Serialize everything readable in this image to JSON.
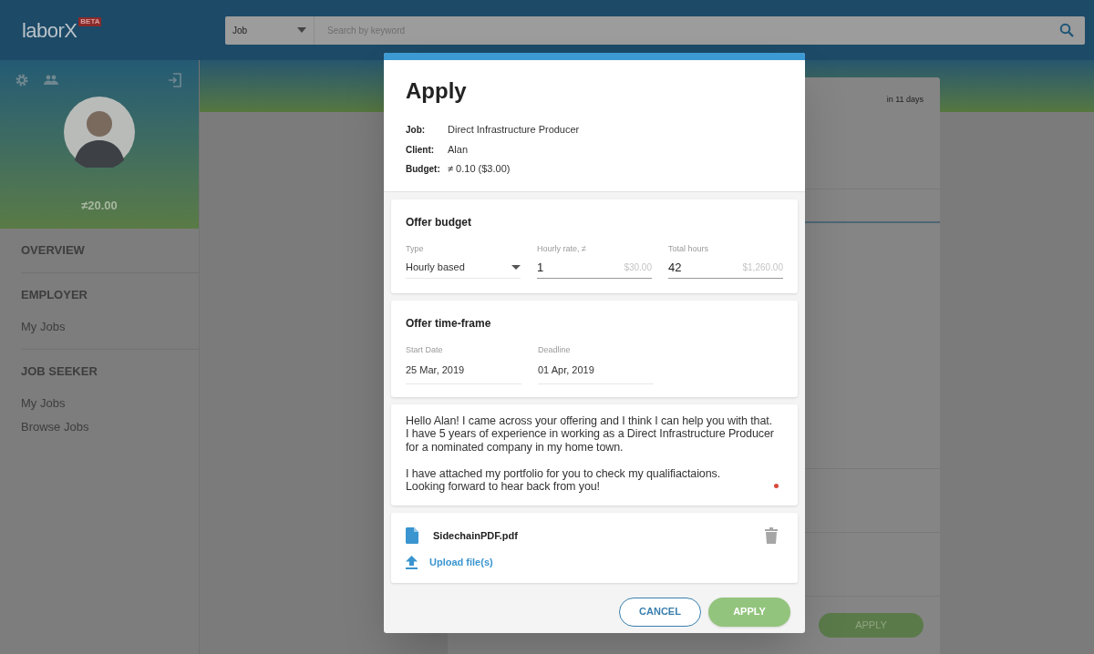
{
  "header": {
    "logo": "laborX",
    "badge": "BETA",
    "search": {
      "category": "Job",
      "placeholder": "Search by keyword"
    }
  },
  "sidebar": {
    "balance": "≠20.00",
    "sections": [
      {
        "title": "OVERVIEW"
      },
      {
        "title": "EMPLOYER",
        "items": [
          "My Jobs"
        ]
      },
      {
        "title": "JOB SEEKER",
        "items": [
          "My Jobs",
          "Browse Jobs"
        ]
      }
    ]
  },
  "background_card": {
    "due": "in 11 days",
    "button": "APPLY"
  },
  "dialog": {
    "title": "Apply",
    "details": [
      {
        "label": "Job:",
        "value": "Direct Infrastructure Producer"
      },
      {
        "label": "Client:",
        "value": "Alan"
      },
      {
        "label": "Budget:",
        "value": "≠ 0.10 ($3.00)"
      }
    ],
    "offer_budget": {
      "title": "Offer budget",
      "fields": [
        {
          "kind": "select",
          "label": "Type",
          "value": "Hourly based"
        },
        {
          "kind": "input",
          "label": "Hourly rate, ≠",
          "value": "1",
          "hint": "$30.00"
        },
        {
          "kind": "input",
          "label": "Total hours",
          "value": "42",
          "hint": "$1,260.00"
        }
      ]
    },
    "time_frame": {
      "title": "Offer time-frame",
      "fields": [
        {
          "label": "Start Date",
          "value": "25 Mar, 2019"
        },
        {
          "label": "Deadline",
          "value": "01 Apr, 2019"
        }
      ]
    },
    "message": "Hello Alan! I came across your offering and I think I can help you with that.\nI have 5 years of experience in working as a Direct Infrastructure Producer\nfor a nominated company in my home town.\n\nI have attached my portfolio for you to check my qualifiactaions.\nLooking forward to hear back from you!",
    "files": [
      {
        "name": "SidechainPDF.pdf"
      }
    ],
    "upload": "Upload file(s)",
    "buttons": [
      {
        "kind": "secondary",
        "label": "CANCEL"
      },
      {
        "kind": "primary",
        "label": "APPLY"
      }
    ]
  }
}
